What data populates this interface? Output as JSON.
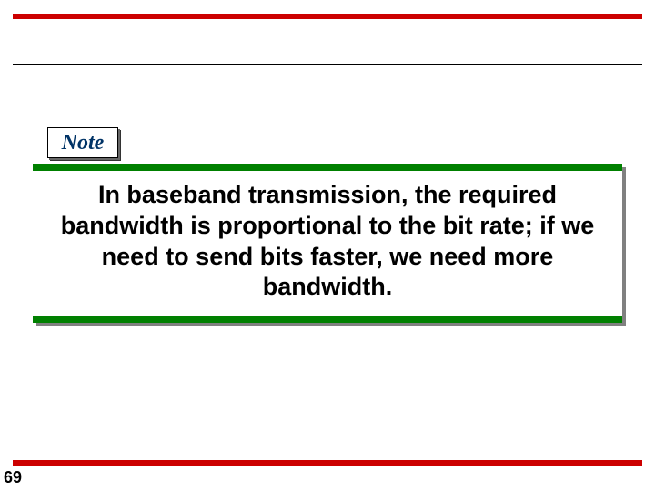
{
  "note": {
    "label": "Note",
    "body": "In baseband transmission, the required bandwidth is proportional to the bit rate; if we need to send bits faster, we need more bandwidth."
  },
  "page_number": "69"
}
